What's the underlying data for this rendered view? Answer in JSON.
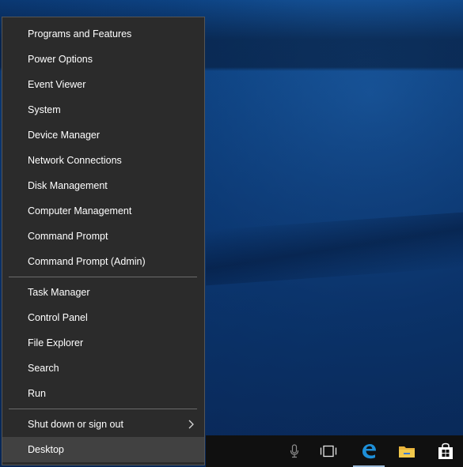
{
  "menu": {
    "items": [
      {
        "label": "Programs and Features"
      },
      {
        "label": "Power Options"
      },
      {
        "label": "Event Viewer"
      },
      {
        "label": "System"
      },
      {
        "label": "Device Manager"
      },
      {
        "label": "Network Connections"
      },
      {
        "label": "Disk Management"
      },
      {
        "label": "Computer Management"
      },
      {
        "label": "Command Prompt"
      },
      {
        "label": "Command Prompt (Admin)"
      },
      {
        "label": "Task Manager"
      },
      {
        "label": "Control Panel"
      },
      {
        "label": "File Explorer"
      },
      {
        "label": "Search"
      },
      {
        "label": "Run"
      },
      {
        "label": "Shut down or sign out"
      },
      {
        "label": "Desktop"
      }
    ],
    "hovered_item": "Desktop"
  },
  "taskbar": {
    "icons": [
      "microphone-icon",
      "task-view-icon",
      "edge-icon",
      "file-explorer-icon",
      "store-icon"
    ]
  },
  "colors": {
    "menu_bg": "#2b2b2b",
    "menu_hover": "#414141",
    "taskbar_bg": "#101010",
    "edge_blue": "#1e8fd8",
    "folder_yellow": "#f2c94c"
  }
}
